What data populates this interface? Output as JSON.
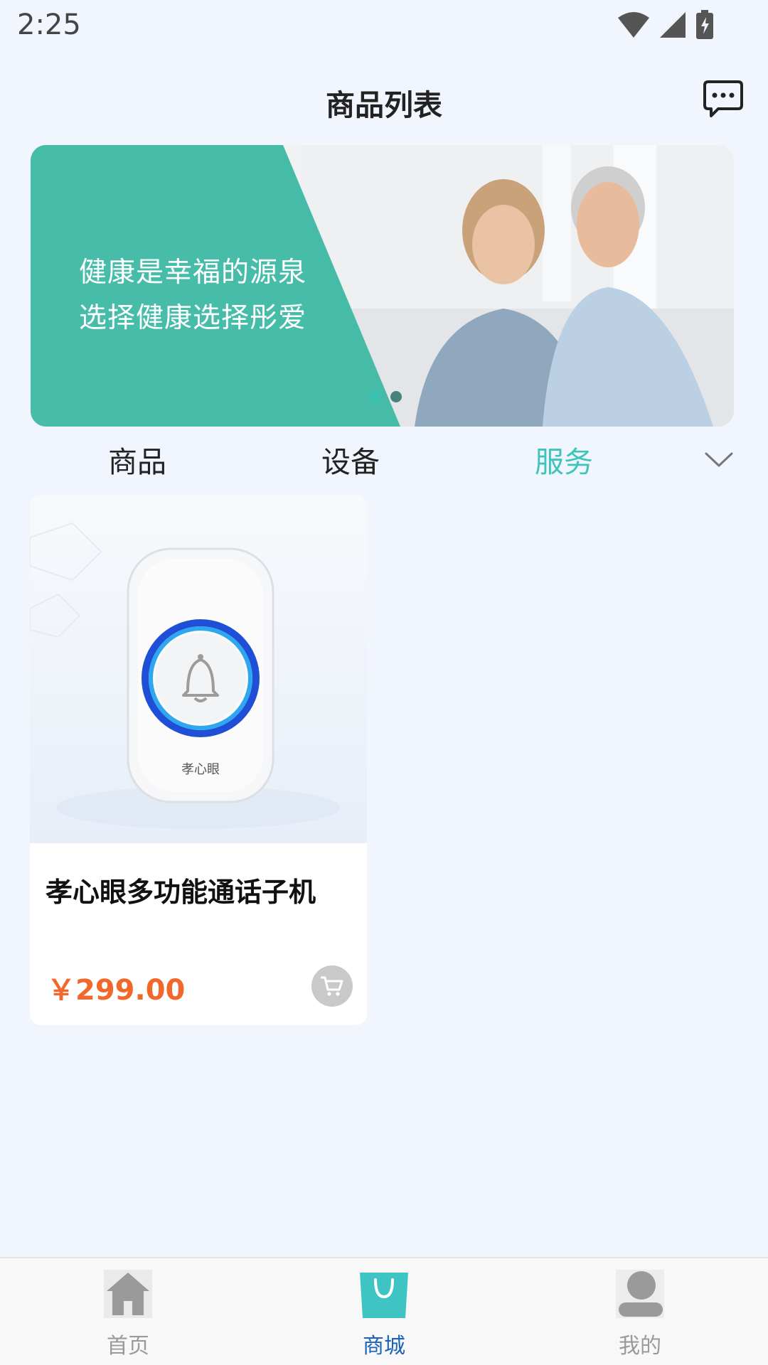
{
  "status_bar": {
    "time": "2:25",
    "icons": [
      "wifi-icon",
      "signal-icon",
      "battery-charging-icon"
    ]
  },
  "header": {
    "title": "商品列表",
    "message_icon": "chat-bubble-icon"
  },
  "banner": {
    "line1": "健康是幸福的源泉",
    "line2": "选择健康选择彤爱",
    "dots": 2,
    "active_dot": 1,
    "accent_color": "#3bbfaa"
  },
  "tabs": {
    "items": [
      {
        "label": "商品"
      },
      {
        "label": "设备"
      },
      {
        "label": "服务"
      }
    ],
    "active_index": 2,
    "active_color": "#3ec5ba",
    "dropdown_icon": "chevron-down-icon"
  },
  "products": [
    {
      "name": "孝心眼多功能通话子机",
      "price": "￥299.00",
      "image_brand": "孝心眼",
      "cart_icon": "cart-icon"
    }
  ],
  "bottom_nav": {
    "items": [
      {
        "label": "首页",
        "icon": "home-icon"
      },
      {
        "label": "商城",
        "icon": "shopping-bag-icon"
      },
      {
        "label": "我的",
        "icon": "user-icon"
      }
    ],
    "active_index": 1,
    "active_color": "#1b63b8",
    "price_color": "#f2672c"
  }
}
